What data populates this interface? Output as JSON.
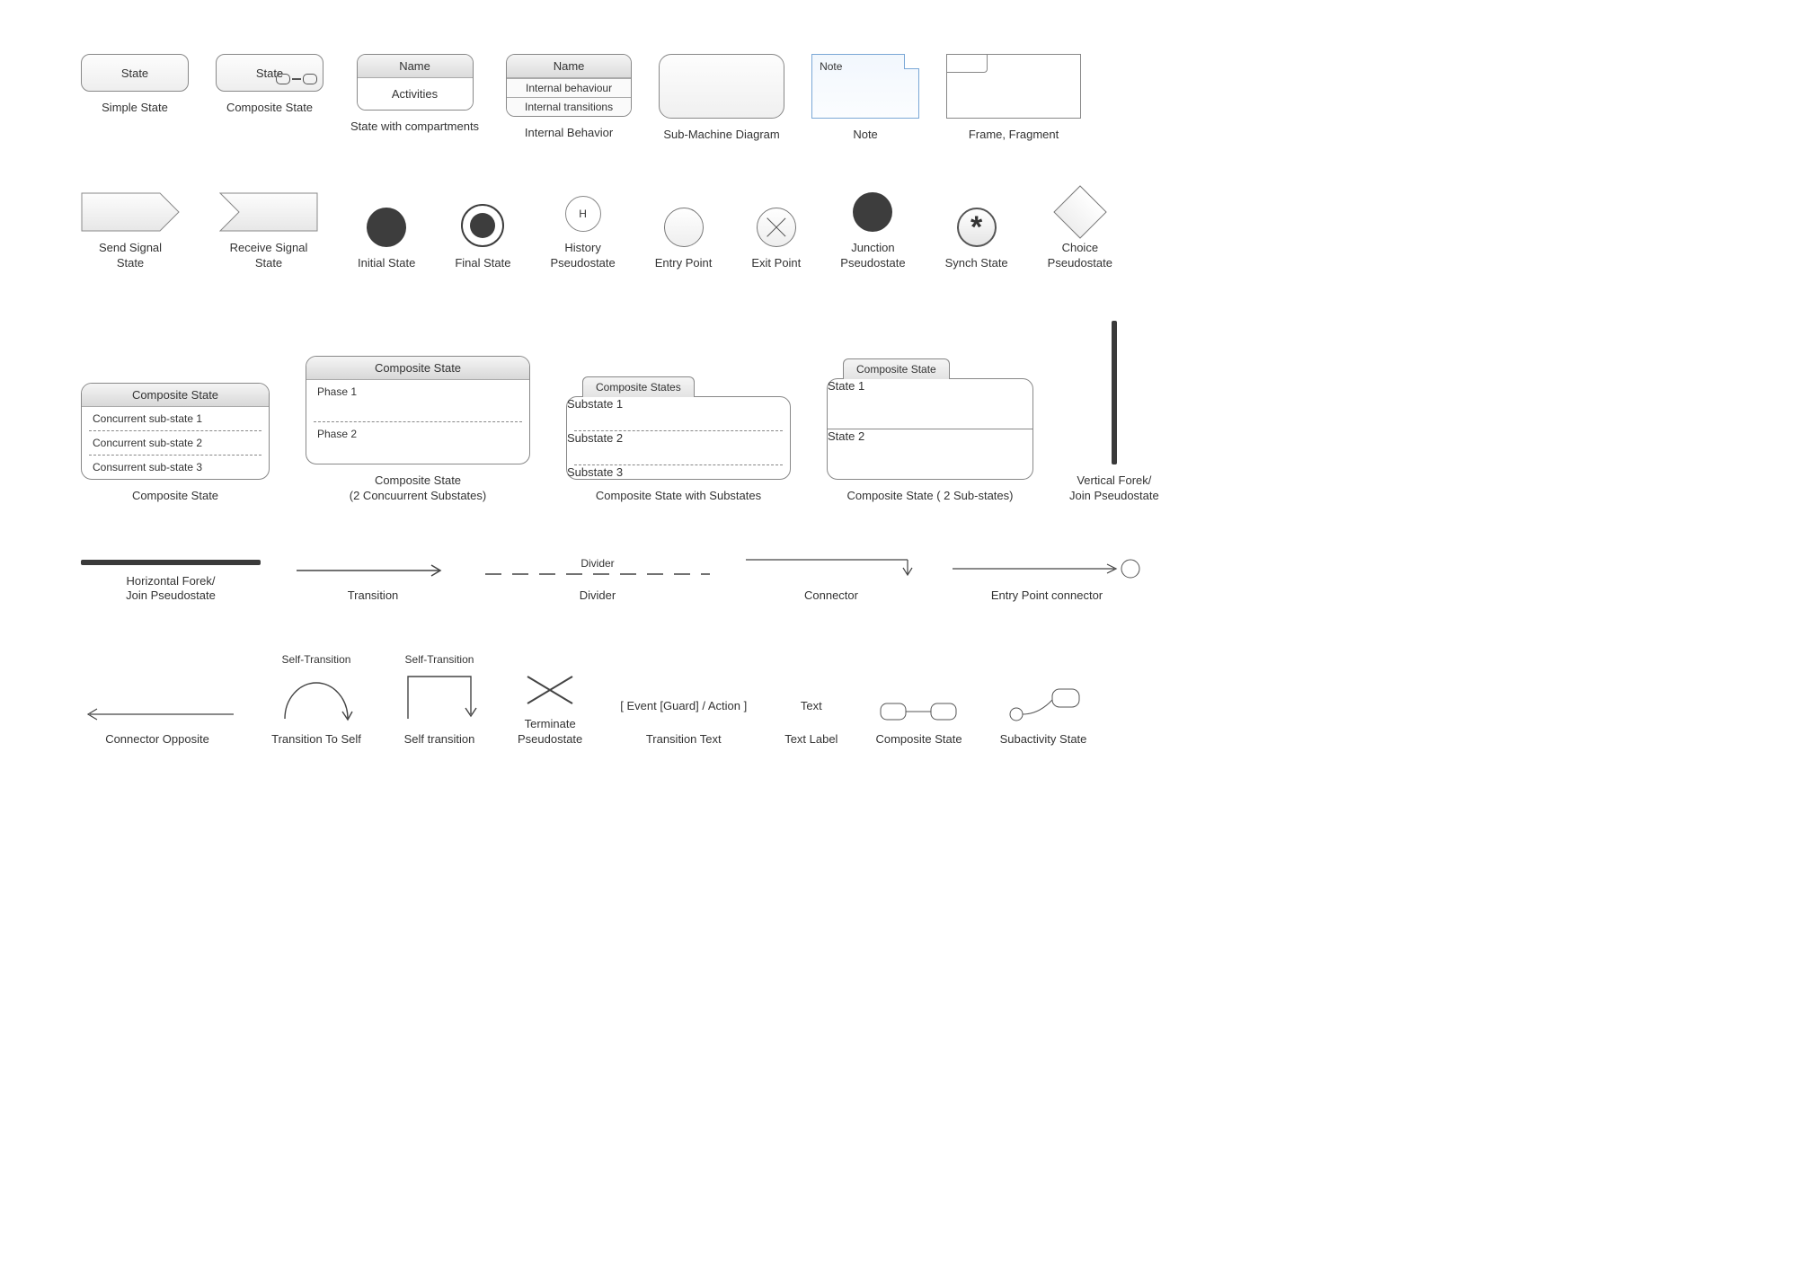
{
  "row1": {
    "simple_state": {
      "text": "State",
      "caption": "Simple State"
    },
    "composite_state_small": {
      "text": "State",
      "caption": "Composite State"
    },
    "compartments": {
      "head": "Name",
      "body": "Activities",
      "caption": "State with compartments"
    },
    "internal_behavior": {
      "head": "Name",
      "r1": "Internal behaviour",
      "r2": "Internal transitions",
      "caption": "Internal Behavior"
    },
    "submachine": {
      "caption": "Sub-Machine Diagram"
    },
    "note": {
      "text": "Note",
      "caption": "Note"
    },
    "frame": {
      "caption": "Frame, Fragment"
    }
  },
  "row2": {
    "send_signal": {
      "caption": "Send Signal\nState"
    },
    "receive_signal": {
      "caption": "Receive Signal\nState"
    },
    "initial": {
      "caption": "Initial State"
    },
    "final": {
      "caption": "Final State"
    },
    "history": {
      "text": "H",
      "caption": "History\nPseudostate"
    },
    "entry": {
      "caption": "Entry Point"
    },
    "exit": {
      "caption": "Exit Point"
    },
    "junction": {
      "caption": "Junction\nPseudostate"
    },
    "synch": {
      "text": "*",
      "caption": "Synch State"
    },
    "choice": {
      "caption": "Choice\nPseudostate"
    }
  },
  "row3": {
    "comp3": {
      "head": "Composite State",
      "r1": "Concurrent sub-state 1",
      "r2": "Concurrent sub-state 2",
      "r3": "Consurrent sub-state 3",
      "caption": "Composite State"
    },
    "comp2": {
      "head": "Composite State",
      "r1": "Phase 1",
      "r2": "Phase 2",
      "caption": "Composite State\n(2 Concuurrent Substates)"
    },
    "comp_sub": {
      "tab": "Composite States",
      "r1": "Substate 1",
      "r2": "Substate 2",
      "r3": "Substate 3",
      "caption": "Composite State with Substates"
    },
    "comp_2sub": {
      "tab": "Composite State",
      "r1": "State 1",
      "r2": "State 2",
      "caption": "Composite State ( 2 Sub-states)"
    },
    "vfork": {
      "caption": "Vertical Forek/\nJoin Pseudostate"
    }
  },
  "row4": {
    "hfork": {
      "caption": "Horizontal Forek/\nJoin Pseudostate"
    },
    "transition": {
      "caption": "Transition"
    },
    "divider": {
      "text": "Divider",
      "caption": "Divider"
    },
    "connector": {
      "caption": "Connector"
    },
    "entry_conn": {
      "caption": "Entry Point connector"
    }
  },
  "row5": {
    "conn_opp": {
      "caption": "Connector Opposite"
    },
    "self_trans": {
      "label": "Self-Transition",
      "caption": "Transition To Self"
    },
    "self_trans2": {
      "label": "Self-Transition",
      "caption": "Self transition"
    },
    "terminate": {
      "caption": "Terminate\nPseudostate"
    },
    "ttext": {
      "text": "[ Event [Guard] / Action ]",
      "caption": "Transition Text"
    },
    "tlabel": {
      "text": "Text",
      "caption": "Text Label"
    },
    "comp_mini": {
      "caption": "Composite State"
    },
    "subact": {
      "caption": "Subactivity State"
    }
  }
}
